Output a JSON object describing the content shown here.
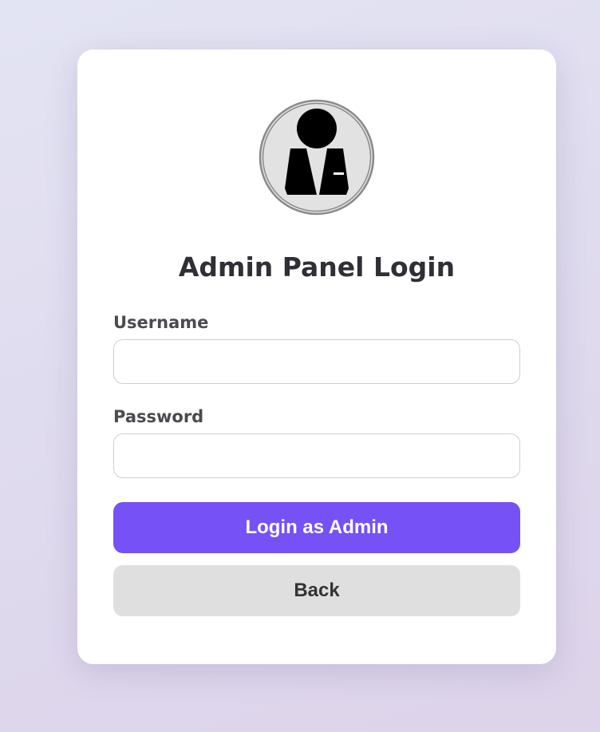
{
  "colors": {
    "accent": "#7651f5",
    "back_button_bg": "#dfdfdf",
    "card_bg": "#ffffff",
    "title_text": "#2f2f35"
  },
  "login_card": {
    "avatar_icon": "admin-user-icon",
    "title": "Admin Panel Login",
    "username": {
      "label": "Username",
      "value": "",
      "placeholder": ""
    },
    "password": {
      "label": "Password",
      "value": "",
      "placeholder": ""
    },
    "login_button_label": "Login as Admin",
    "back_button_label": "Back"
  }
}
